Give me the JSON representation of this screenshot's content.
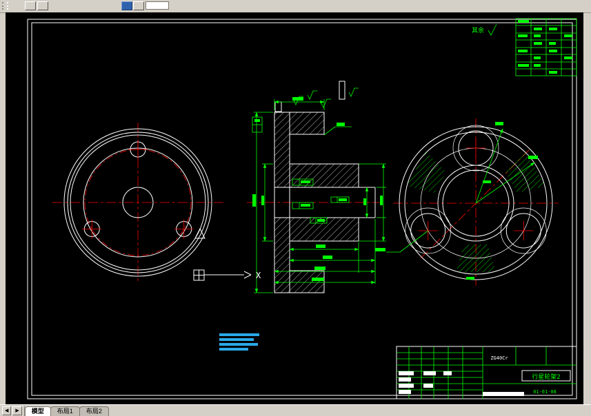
{
  "colors": {
    "canvas_background": "#000000",
    "geometry_white": "#ffffff",
    "centerline_red": "#ff0000",
    "annotation_green": "#00ff00",
    "highlight_cyan": "#2aa9e8",
    "chrome_gray": "#d4d0c8",
    "toolbar_blue": "#2f62ad"
  },
  "toolbar": {
    "input_value": ""
  },
  "annotations": {
    "roughness_note": "其余",
    "ucs_axis_label": "X"
  },
  "title_block": {
    "material": "ZG40Cr",
    "part_name": "行星轮架2",
    "drawing_number": "01-01-08"
  },
  "status_bar": {
    "scroll_left": "◀",
    "scroll_right": "▶",
    "tabs": {
      "model": "模型",
      "layout1": "布局1",
      "layout2": "布局2"
    }
  }
}
